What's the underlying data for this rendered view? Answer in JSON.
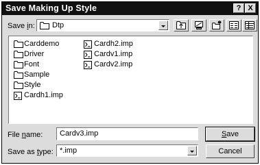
{
  "dialog": {
    "title": "Save Making Up Style",
    "help_glyph": "?",
    "close_glyph": "X"
  },
  "save_in": {
    "label_pre": "Save ",
    "label_key": "i",
    "label_post": "n:",
    "value": "Dtp",
    "icon": "folder-icon"
  },
  "toolbar": {
    "buttons": [
      {
        "name": "up-one-level-button",
        "icon": "up-folder-icon"
      },
      {
        "name": "desktop-button",
        "icon": "desktop-icon"
      },
      {
        "name": "new-folder-button",
        "icon": "new-folder-icon"
      },
      {
        "name": "list-view-button",
        "icon": "list-view-icon"
      },
      {
        "name": "details-view-button",
        "icon": "details-view-icon"
      }
    ]
  },
  "file_list": {
    "column1": [
      {
        "name": "Carddemo",
        "type": "folder"
      },
      {
        "name": "Driver",
        "type": "folder"
      },
      {
        "name": "Font",
        "type": "folder"
      },
      {
        "name": "Sample",
        "type": "folder"
      },
      {
        "name": "Style",
        "type": "folder"
      },
      {
        "name": "Cardh1.imp",
        "type": "file"
      }
    ],
    "column2": [
      {
        "name": "Cardh2.imp",
        "type": "file"
      },
      {
        "name": "Cardv1.imp",
        "type": "file"
      },
      {
        "name": "Cardv2.imp",
        "type": "file"
      }
    ]
  },
  "file_name": {
    "label_pre": "File ",
    "label_key": "n",
    "label_post": "ame:",
    "value": "Cardv3.imp"
  },
  "save_as_type": {
    "label_pre": "Save as ",
    "label_key": "t",
    "label_post": "ype:",
    "value": "*.imp"
  },
  "buttons": {
    "save_key": "S",
    "save_rest": "ave",
    "cancel": "Cancel"
  }
}
